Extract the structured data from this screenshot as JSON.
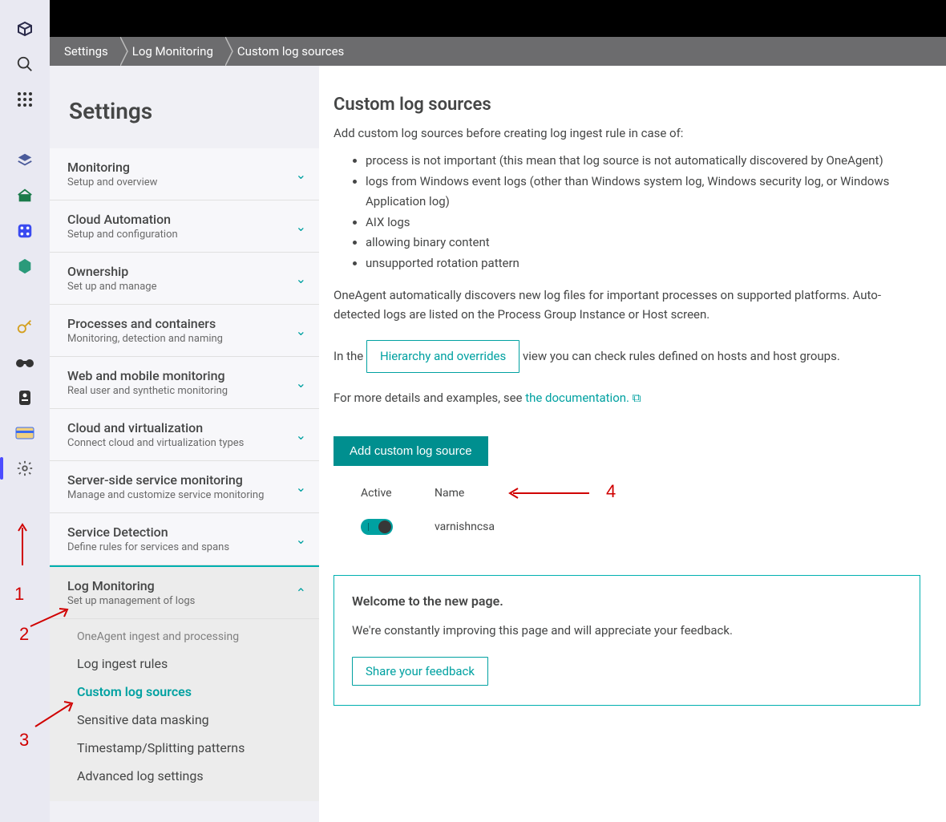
{
  "breadcrumb": {
    "items": [
      "Settings",
      "Log Monitoring",
      "Custom log sources"
    ]
  },
  "panel": {
    "title": "Settings",
    "sections": [
      {
        "label": "Monitoring",
        "sub": "Setup and overview"
      },
      {
        "label": "Cloud Automation",
        "sub": "Setup and configuration"
      },
      {
        "label": "Ownership",
        "sub": "Set up and manage"
      },
      {
        "label": "Processes and containers",
        "sub": "Monitoring, detection and naming"
      },
      {
        "label": "Web and mobile monitoring",
        "sub": "Real user and synthetic monitoring"
      },
      {
        "label": "Cloud and virtualization",
        "sub": "Connect cloud and virtualization types"
      },
      {
        "label": "Server-side service monitoring",
        "sub": "Manage and customize service monitoring"
      },
      {
        "label": "Service Detection",
        "sub": "Define rules for services and spans"
      },
      {
        "label": "Log Monitoring",
        "sub": "Set up management of logs"
      }
    ],
    "log_sub": {
      "group": "OneAgent ingest and processing",
      "items": [
        "Log ingest rules",
        "Custom log sources",
        "Sensitive data masking",
        "Timestamp/Splitting patterns",
        "Advanced log settings"
      ]
    }
  },
  "main": {
    "title": "Custom log sources",
    "intro": "Add custom log sources before creating log ingest rule in case of:",
    "bullets": [
      "process is not important (this mean that log source is not automatically discovered by OneAgent)",
      "logs from Windows event logs (other than Windows system log, Windows security log, or Windows Application log)",
      "AIX logs",
      "allowing binary content",
      "unsupported rotation pattern"
    ],
    "para2": "OneAgent automatically discovers new log files for important processes on supported platforms. Auto-detected logs are listed on the Process Group Instance or Host screen.",
    "inthe_pre": "In the ",
    "hierarchy_btn": "Hierarchy and overrides",
    "inthe_post": " view you can check rules defined on hosts and host groups.",
    "more_pre": "For more details and examples, see ",
    "doc_link": "the documentation.",
    "add_btn": "Add custom log source",
    "th_active": "Active",
    "th_name": "Name",
    "row_name": "varnishncsa",
    "fb_title": "Welcome to the new page.",
    "fb_body": "We're constantly improving this page and will appreciate your feedback.",
    "fb_btn": "Share your feedback"
  },
  "annotations": {
    "n1": "1",
    "n2": "2",
    "n3": "3",
    "n4": "4"
  }
}
